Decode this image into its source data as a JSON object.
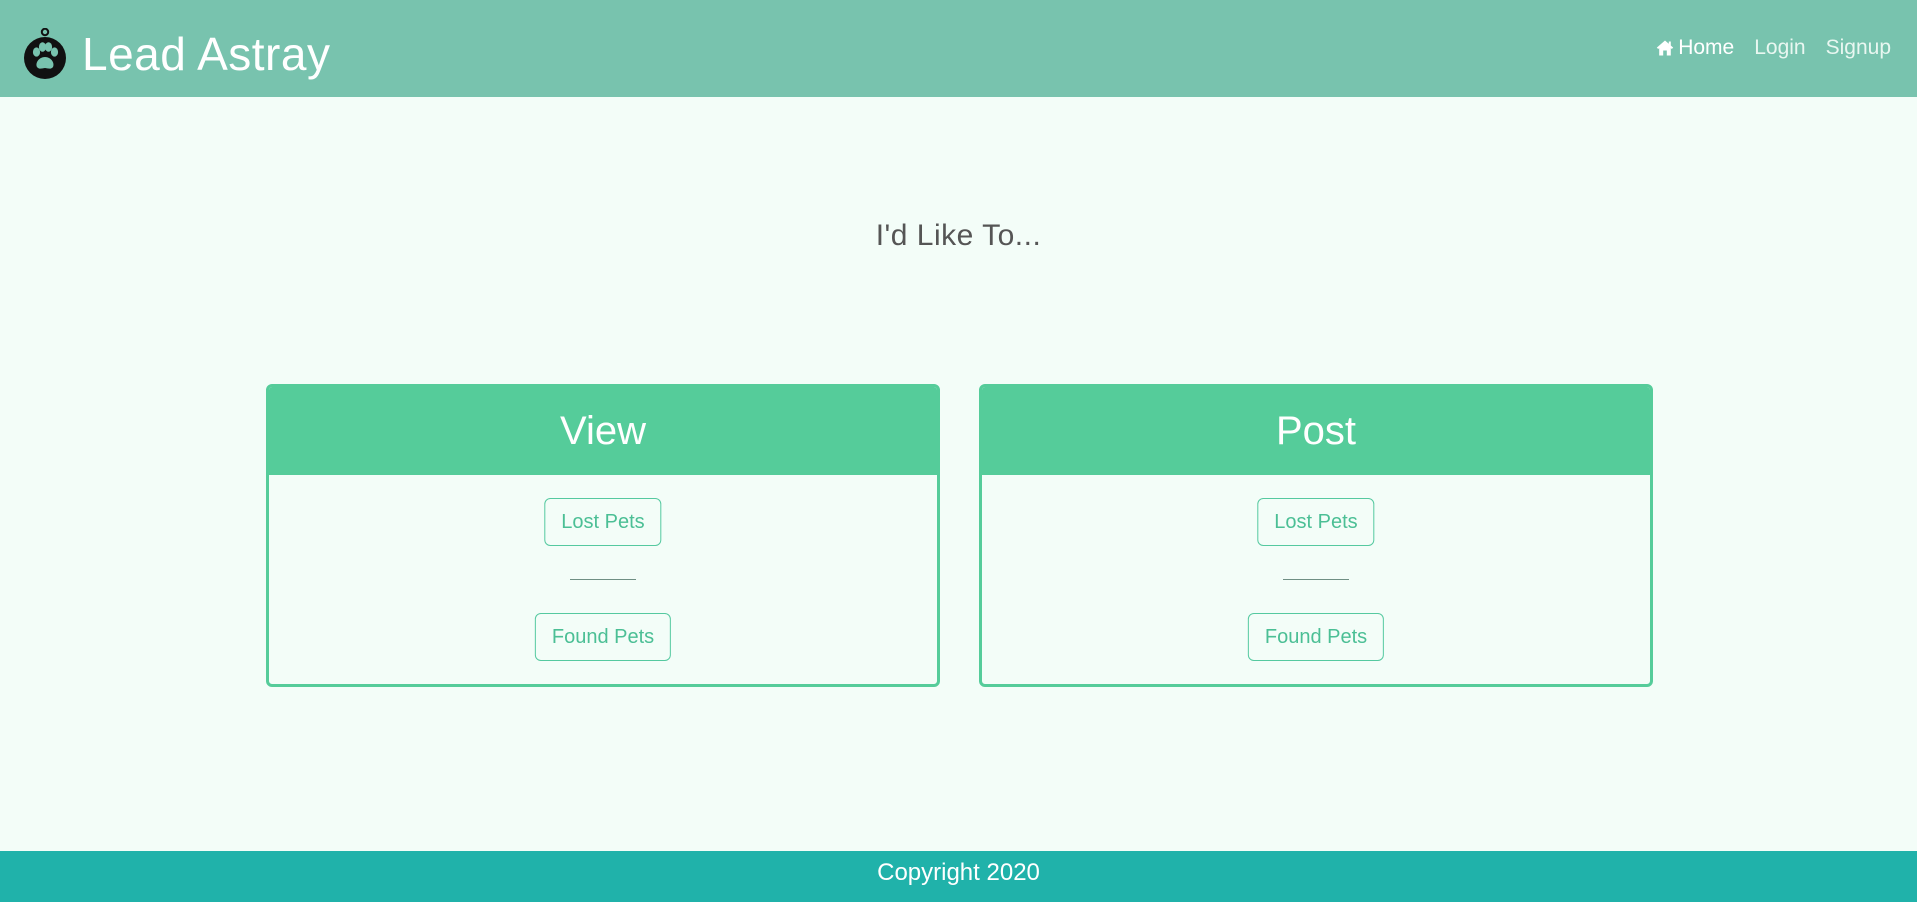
{
  "brand": {
    "name": "Lead Astray",
    "logo_icon": "paw-tag-icon"
  },
  "nav": {
    "items": [
      {
        "label": "Home",
        "icon": "home-icon",
        "active": true
      },
      {
        "label": "Login",
        "active": false
      },
      {
        "label": "Signup",
        "active": false
      }
    ]
  },
  "main": {
    "prompt": "I'd Like To..."
  },
  "cards": [
    {
      "title": "View",
      "lost_label": "Lost Pets",
      "found_label": "Found Pets"
    },
    {
      "title": "Post",
      "lost_label": "Lost Pets",
      "found_label": "Found Pets"
    }
  ],
  "footer": {
    "text": "Copyright 2020"
  },
  "colors": {
    "navbar": "#78c3ae",
    "page_background": "#f3fdf8",
    "card_accent": "#55cc9a",
    "button_text": "#4bbf95",
    "footer": "#20b2aa"
  }
}
